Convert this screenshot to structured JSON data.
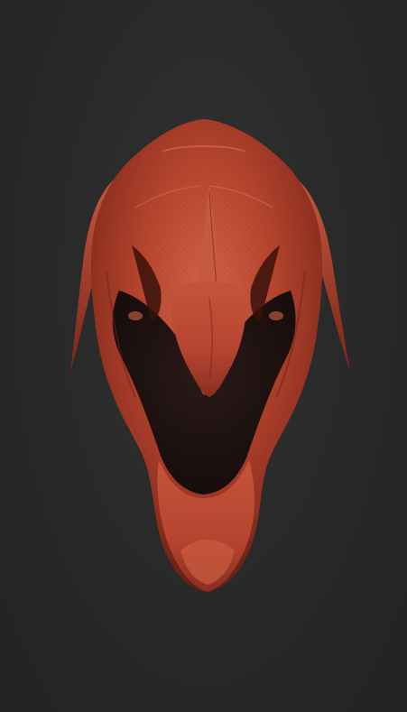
{
  "scene": {
    "subject": "sculpted-creature-head",
    "background_color": "#2a2a2a",
    "material_color": "#b8462f",
    "material_highlight": "#d86a4f",
    "material_shadow": "#6e2216",
    "cavity_color": "#1e1414"
  }
}
